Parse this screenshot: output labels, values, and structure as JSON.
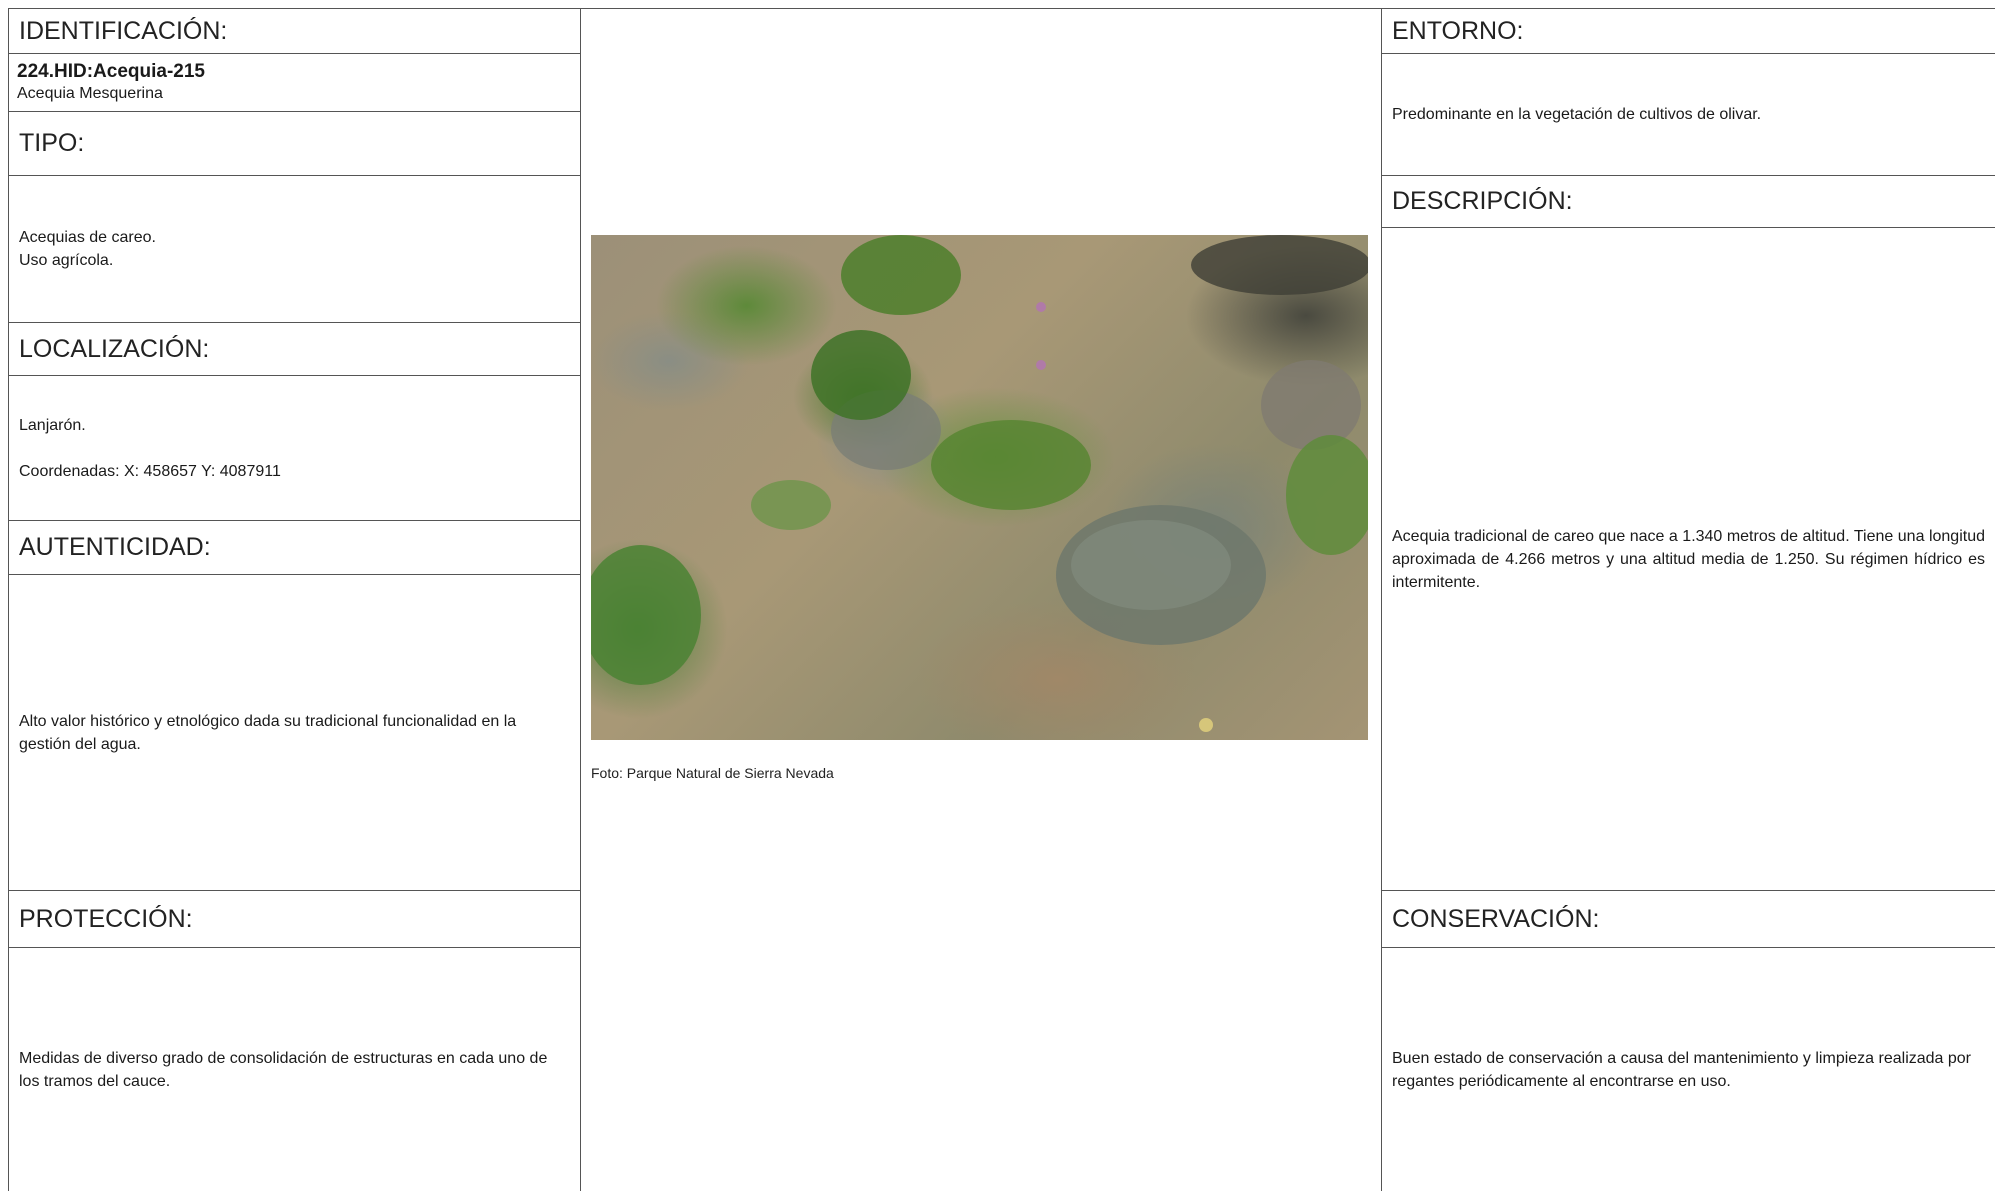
{
  "identificacion": {
    "header": "IDENTIFICACIÓN:",
    "code": "224.HID:Acequia-215",
    "name": "Acequia Mesquerina"
  },
  "tipo": {
    "header": "TIPO:",
    "lines": [
      "Acequias de careo.",
      "Uso agrícola."
    ]
  },
  "localizacion": {
    "header": "LOCALIZACIÓN:",
    "place": "Lanjarón.",
    "coords": "Coordenadas: X: 458657 Y: 4087911"
  },
  "autenticidad": {
    "header": "AUTENTICIDAD:",
    "text": "Alto valor histórico y etnológico dada su tradicional funcionalidad en la gestión del agua."
  },
  "proteccion": {
    "header": "PROTECCIÓN:",
    "text": "Medidas de diverso grado de consolidación de estructuras en cada uno de los tramos del cauce."
  },
  "photo": {
    "caption": "Foto: Parque Natural de Sierra Nevada"
  },
  "entorno": {
    "header": "ENTORNO:",
    "text": "Predominante en la vegetación de cultivos de olivar."
  },
  "descripcion": {
    "header": "DESCRIPCIÓN:",
    "text": "Acequia tradicional de careo que nace a 1.340 metros de altitud. Tiene una longitud aproximada de 4.266 metros y una altitud media de 1.250. Su régimen hídrico es intermitente."
  },
  "conservacion": {
    "header": "CONSERVACIÓN:",
    "text": "Buen estado de conservación a causa del mantenimiento y limpieza realizada por regantes periódicamente al encontrarse en uso."
  }
}
